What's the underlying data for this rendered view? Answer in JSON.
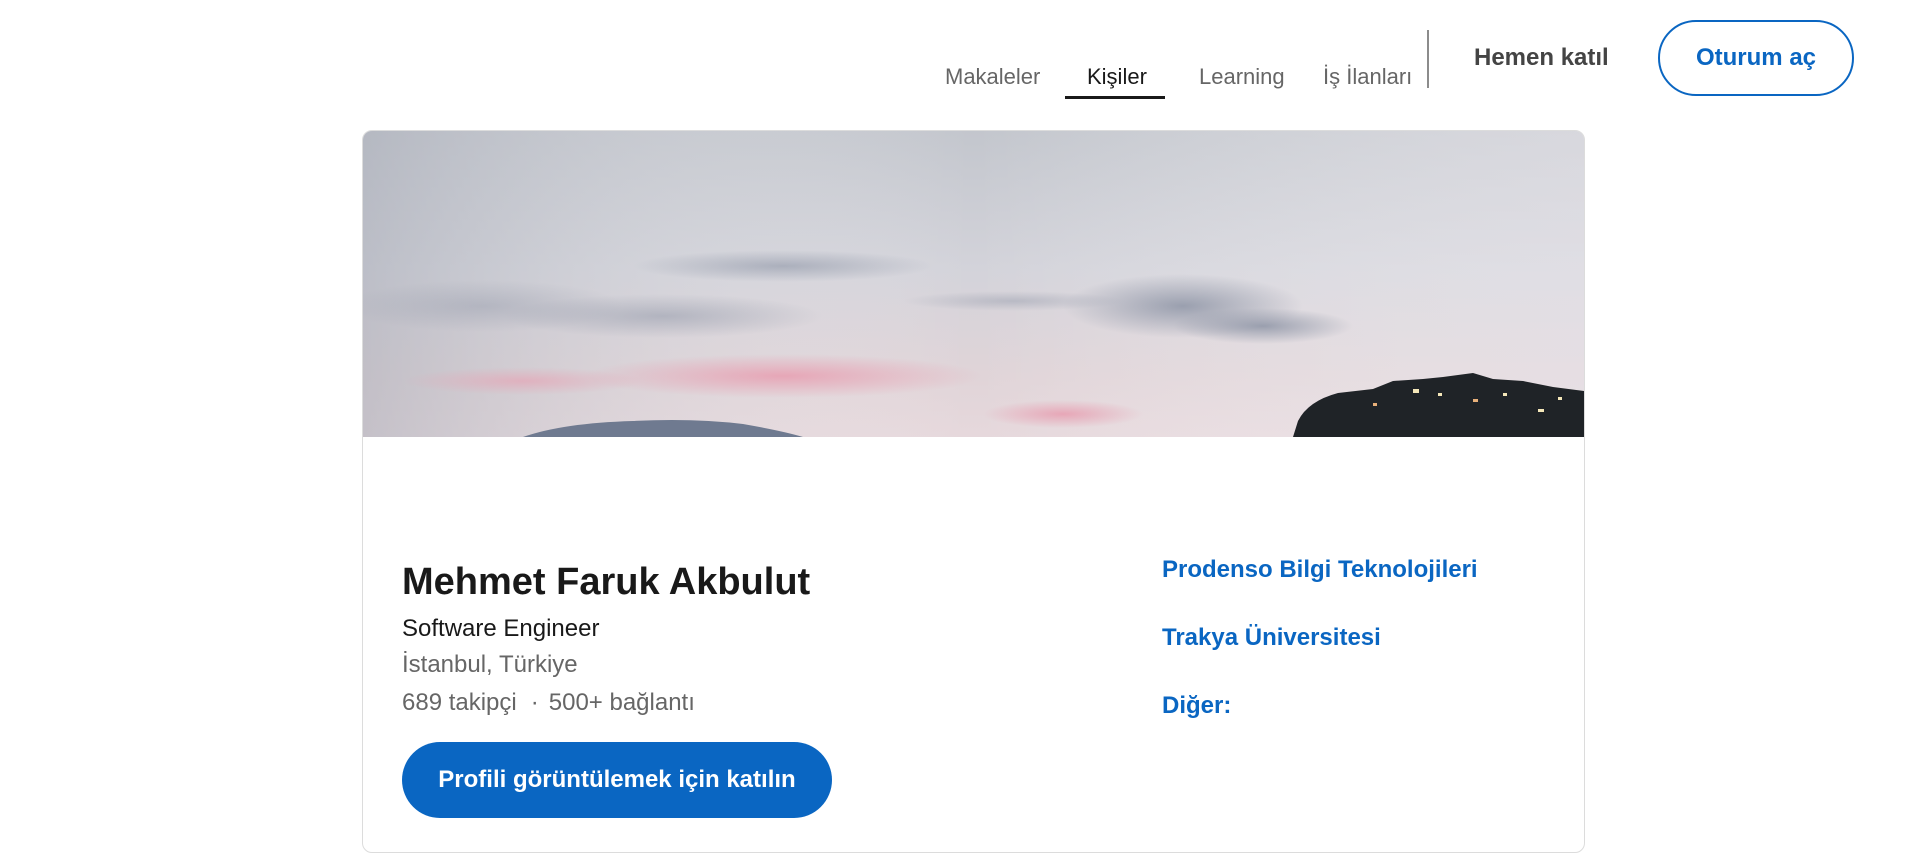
{
  "nav": {
    "links": [
      {
        "label": "Makaleler"
      },
      {
        "label": "Kişiler"
      },
      {
        "label": "Learning"
      },
      {
        "label": "İş İlanları"
      }
    ],
    "join_now": "Hemen katıl",
    "sign_in": "Oturum aç"
  },
  "profile": {
    "name": "Mehmet Faruk Akbulut",
    "headline": "Software Engineer",
    "location": "İstanbul, Türkiye",
    "followers": "689 takipçi",
    "separator": "·",
    "connections": "500+ bağlantı",
    "join_button": "Profili görüntülemek için katılın",
    "company": "Prodenso Bilgi Teknolojileri",
    "education": "Trakya Üniversitesi",
    "other": "Diğer:"
  },
  "colors": {
    "brand": "#0a66c2",
    "text": "#191919",
    "muted": "#666666"
  }
}
